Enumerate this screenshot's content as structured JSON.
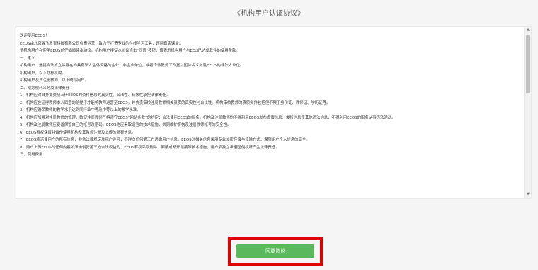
{
  "page": {
    "title": "《机构用户认证协议》"
  },
  "agreement": {
    "lines": [
      "欢迎使用EEOS！",
      "EEOS由北京翼飞教育科技有限公司负责运营，致力于打造专业的在线学习工具，还原真实课堂。",
      "请机构用户在使用EEOS前仔细阅读本协议。机构用户接受本协议点击\"同意\"按钮，该表示机构用户与EEO已达成软件的使用条款。",
      "一、定义",
      "机构用户：是指合法成立并存在的具有法人主体资格的企业、非企业单位，或者个体教师工作室以团体名义入驻EEOS的非法人单位。",
      "机构用户，以下亦称机构。",
      "机构用户及其注册教师，以下统称用户。",
      "二、双方权利义务及法律责任",
      "1、机构应对自身提交及上传EEOS的资料信息的真实性、合法性、有效性承担法律责任。",
      "2、机构应在证得教师本人同意的前提下才能将教师运营至EEOS，并负责审核注册教师相关资质的真实性与合法性。机构审核教师的资质文件包括但不限于身份证、教师证、学历证等。",
      "3、机构应确保教师的教学水平达到同行业中等及中等以上的教学水准。",
      "4、机构应加强对注册教师的管理，教促注册教师严格遵守EEOS“网站条款”的约定；合法使用EEOS的服务。机构及注册教师均不得利用EEOS发布虚假信息、侵权信息及其他违法信息，不得利用EEOS的服务从事违法活动。",
      "5、机构及注册教师应妥善保管自己的帐号及密码，EEOS也应采取适当的技术措施，共同维护机构及注册教师帐号的安全性。",
      "6、EEOS有权保留并备份使用机构及其教师注册及上传的所有信息。",
      "7、EEOS承诺使用户的所有信息，非依法律规定及用户许可，不得向任何第三方透露用户信息。EEOS对相关信息采用专业加密存储与传输方式，保障用户个人信息的安全。",
      "8、用户上传EEOS的任何内容如涉嫌侵犯第三方合法权益的，EEOS有权采取删除、屏蔽或断开链接等技术措施，用户须独立承担因侵权所产生法律责任。",
      "三、使用费用"
    ]
  },
  "actions": {
    "agree_label": "同意协议"
  },
  "colors": {
    "agree_button": "#5cb85c",
    "highlight": "#e00000"
  }
}
